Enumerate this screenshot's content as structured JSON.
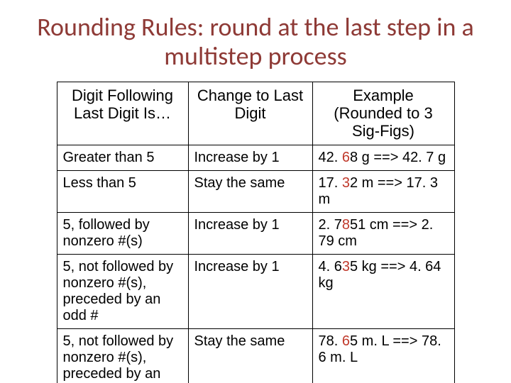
{
  "title": "Rounding Rules: round at the last step in a multistep process",
  "headers": {
    "col1": "Digit Following Last Digit Is…",
    "col2": "Change to Last Digit",
    "col3": "Example (Rounded to 3 Sig-Figs)"
  },
  "rows": [
    {
      "rule": "Greater than 5",
      "change": "Increase by 1",
      "ex_before_pre": "42. ",
      "ex_before_red": "6",
      "ex_before_post": "8 g ==> 42. 7 g"
    },
    {
      "rule": "Less than 5",
      "change": "Stay the same",
      "ex_before_pre": "17. ",
      "ex_before_red": "3",
      "ex_before_post": "2 m ==> 17. 3 m"
    },
    {
      "rule": "5, followed by nonzero #(s)",
      "change": "Increase by 1",
      "ex_before_pre": "2. 7",
      "ex_before_red": "8",
      "ex_before_post": "51 cm ==> 2. 79 cm"
    },
    {
      "rule": "5, not followed by nonzero #(s), preceded by an odd #",
      "change": "Increase by 1",
      "ex_before_pre": "4. 6",
      "ex_before_red": "3",
      "ex_before_post": "5 kg ==> 4. 64 kg"
    },
    {
      "rule": "5, not followed by nonzero #(s), preceded by an",
      "change": "Stay the same",
      "ex_before_pre": "78. ",
      "ex_before_red": "6",
      "ex_before_post": "5 m. L ==> 78. 6 m. L"
    }
  ],
  "chart_data": {
    "type": "table",
    "title": "Rounding Rules: round at the last step in a multistep process",
    "columns": [
      "Digit Following Last Digit Is…",
      "Change to Last Digit",
      "Example (Rounded to 3 Sig-Figs)"
    ],
    "rows": [
      [
        "Greater than 5",
        "Increase by 1",
        "42.68 g ==> 42.7 g"
      ],
      [
        "Less than 5",
        "Stay the same",
        "17.32 m ==> 17.3 m"
      ],
      [
        "5, followed by nonzero #(s)",
        "Increase by 1",
        "2.7851 cm ==> 2.79 cm"
      ],
      [
        "5, not followed by nonzero #(s), preceded by an odd #",
        "Increase by 1",
        "4.635 kg ==> 4.64 kg"
      ],
      [
        "5, not followed by nonzero #(s), preceded by an",
        "Stay the same",
        "78.65 m.L ==> 78.6 m.L"
      ]
    ]
  }
}
